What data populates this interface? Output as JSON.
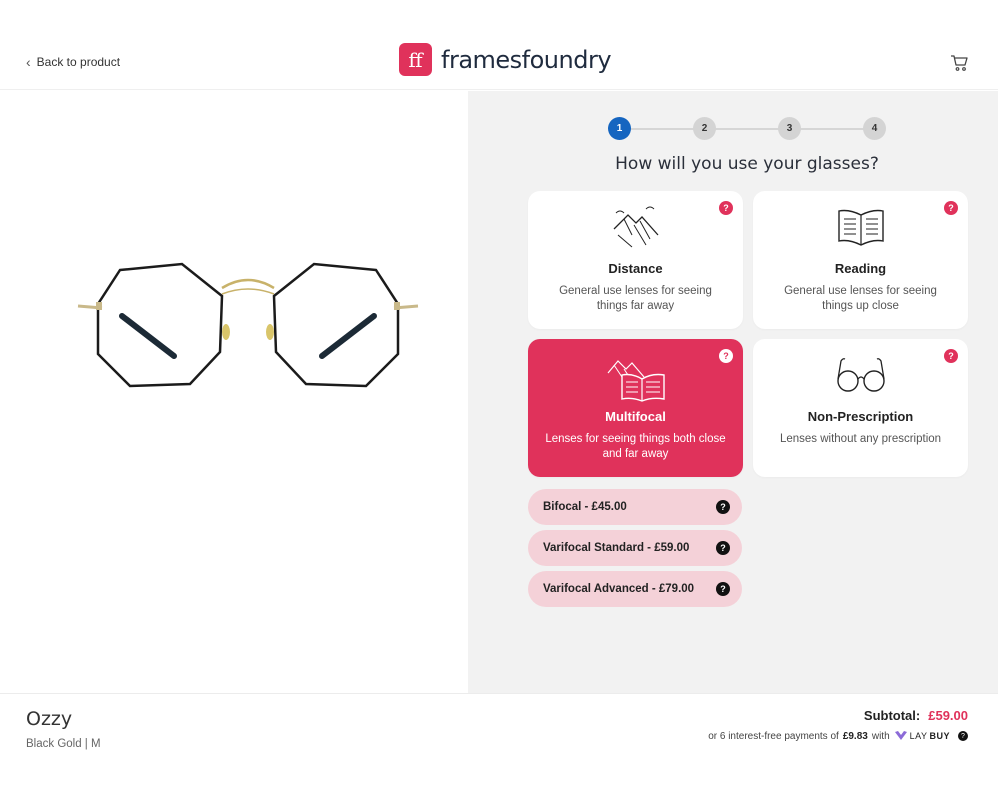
{
  "header": {
    "back_label": "Back to product",
    "logo_mark": "ff",
    "logo_text": "framesfoundry"
  },
  "stepper": {
    "steps": [
      "1",
      "2",
      "3",
      "4"
    ],
    "active_step": 1
  },
  "question": "How will you use your glasses?",
  "cards": [
    {
      "title": "Distance",
      "desc": "General use lenses for seeing things far away",
      "selected": false,
      "icon": "mountain-icon"
    },
    {
      "title": "Reading",
      "desc": "General use lenses for seeing things up close",
      "selected": false,
      "icon": "book-icon"
    },
    {
      "title": "Multifocal",
      "desc": "Lenses for seeing things both close and far away",
      "selected": true,
      "icon": "mountain-book-icon"
    },
    {
      "title": "Non-Prescription",
      "desc": "Lenses without any prescription",
      "selected": false,
      "icon": "glasses-icon"
    }
  ],
  "help_glyph": "?",
  "options": [
    {
      "label": "Bifocal - £45.00"
    },
    {
      "label": "Varifocal Standard - £59.00"
    },
    {
      "label": "Varifocal Advanced - £79.00"
    }
  ],
  "footer": {
    "product_name": "Ozzy",
    "product_variant": "Black Gold | M",
    "subtotal_label": "Subtotal:",
    "subtotal_amount": "£59.00",
    "laybuy_prefix": "or 6 interest-free payments of",
    "laybuy_amount": "£9.83",
    "laybuy_with": "with",
    "laybuy_brand_lay": "LAY",
    "laybuy_brand_buy": "BUY"
  },
  "colors": {
    "accent": "#e0325b",
    "step_active": "#1565c0",
    "option_bg": "#f4d1d8",
    "panel_bg": "#f2f2f2"
  }
}
